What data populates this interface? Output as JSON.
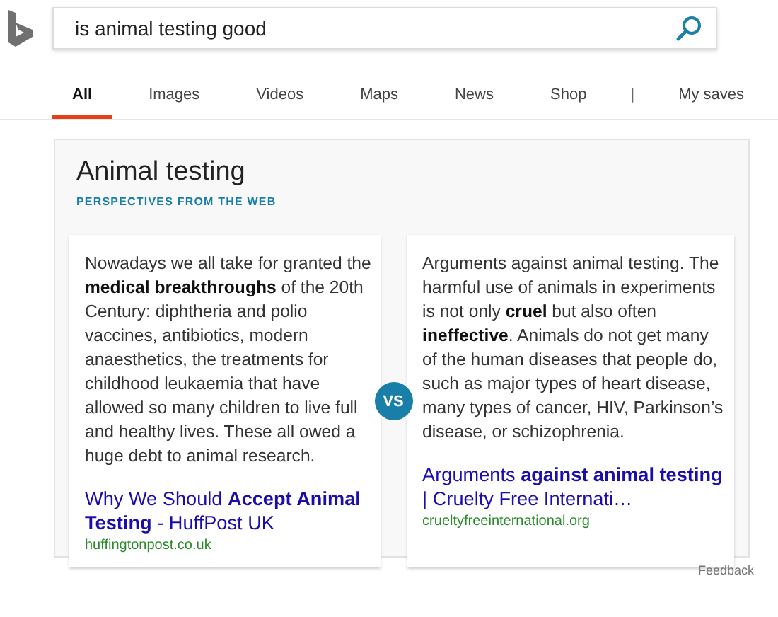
{
  "search": {
    "value": "is animal testing good"
  },
  "nav": {
    "tabs": [
      {
        "label": "All",
        "selected": true
      },
      {
        "label": "Images",
        "selected": false
      },
      {
        "label": "Videos",
        "selected": false
      },
      {
        "label": "Maps",
        "selected": false
      },
      {
        "label": "News",
        "selected": false
      },
      {
        "label": "Shop",
        "selected": false
      }
    ],
    "separator": "|",
    "saves": "My saves"
  },
  "panel": {
    "title": "Animal testing",
    "subtitle": "PERSPECTIVES FROM THE WEB",
    "perspectives": [
      {
        "text": "Nowadays we all take for granted the **medical breakthroughs** of the 20th Century: diphtheria and polio vaccines, antibiotics, modern anaesthetics, the treatments for childhood leukaemia that have allowed so many children to live full and healthy lives. These all owed a huge debt to animal research.",
        "link": "Why We Should **Accept Animal Testing** - HuffPost UK",
        "source": "huffingtonpost.co.uk"
      },
      {
        "text": "Arguments against animal testing. The harmful use of animals in experiments is not only **cruel** but also often **ineffective**. Animals do not get many of the human diseases that people do, such as major types of heart disease, many types of cancer, HIV, Parkinson’s disease, or schizophrenia.",
        "link": "Arguments **against animal testing** | Cruelty Free Internati…",
        "source": "crueltyfreeinternational.org"
      }
    ],
    "versus": "VS"
  },
  "feedback": "Feedback"
}
